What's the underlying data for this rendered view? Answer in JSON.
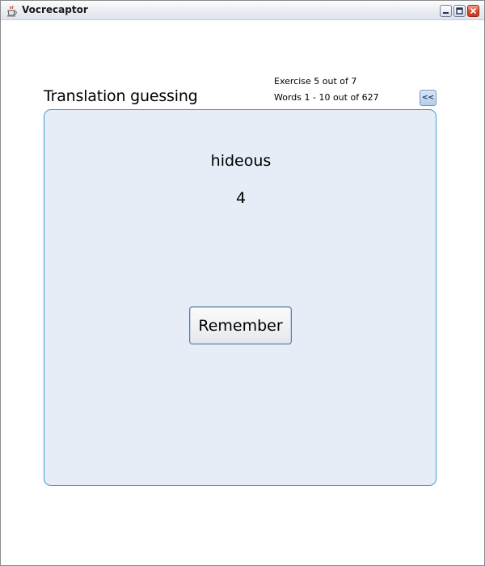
{
  "window": {
    "title": "Vocrecaptor",
    "app_icon": "java-cup-icon",
    "controls": [
      "minimize-icon",
      "maximize-icon",
      "close-icon"
    ]
  },
  "header": {
    "title": "Translation guessing",
    "exercise_info": "Exercise 5 out of 7",
    "words_info": "Words 1 - 10 out of 627",
    "back_label": "<<"
  },
  "card": {
    "word": "hideous",
    "count": "4",
    "remember_label": "Remember"
  },
  "colors": {
    "card_background": "#e6edf6",
    "card_border": "#3aa0d6",
    "back_button": "#b6cdec"
  }
}
